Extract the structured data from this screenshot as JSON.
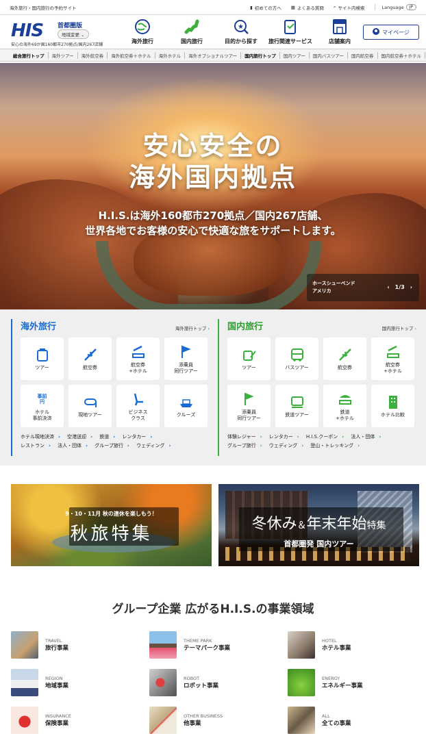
{
  "topbar": {
    "tagline": "海外旅行・国内旅行の予約サイト",
    "links": [
      "初めての方へ",
      "よくある質問",
      "サイト内検索"
    ],
    "language_label": "Language",
    "language_value": "JP"
  },
  "header": {
    "logo": "HIS",
    "area": "首都圏版",
    "area_change": "地域変更",
    "info": "安心の海外69か国160都市270拠点/国内267店舗",
    "nav": [
      "海外旅行",
      "国内旅行",
      "目的から探す",
      "旅行関連サービス",
      "店舗案内"
    ],
    "mypage": "マイページ"
  },
  "subnav": {
    "items": [
      "総合旅行トップ",
      "海外ツアー",
      "海外航空券",
      "海外航空券＋ホテル",
      "海外ホテル",
      "海外オプショナルツアー",
      "国内旅行トップ",
      "国内ツアー",
      "国内バスツアー",
      "国内航空券",
      "国内航空券＋ホテル"
    ]
  },
  "hero": {
    "title_line1": "安心安全の",
    "title_line2": "海外国内拠点",
    "subtitle_line1": "H.I.S.は海外160都市270拠点／国内267店舗、",
    "subtitle_line2": "世界各地でお客様の安心で快適な旅をサポートします。",
    "caption_line1": "ホースシューベンド",
    "caption_line2": "アメリカ",
    "pager": "1/3"
  },
  "overseas": {
    "title": "海外旅行",
    "top_link": "海外旅行トップ",
    "tiles": [
      "ツアー",
      "航空券",
      "航空券\n+ホテル",
      "添乗員\n同行ツアー",
      "ホテル\n事前決済",
      "現地ツアー",
      "ビジネス\nクラス",
      "クルーズ"
    ],
    "tile5_badge": "事前\n円",
    "links": [
      "ホテル現地決済",
      "空港送迎",
      "鉄道",
      "レンタカー",
      "レストラン",
      "法人・団体",
      "グループ旅行",
      "ウェディング"
    ]
  },
  "domestic": {
    "title": "国内旅行",
    "top_link": "国内旅行トップ",
    "tiles": [
      "ツアー",
      "バスツアー",
      "航空券",
      "航空券\n+ホテル",
      "添乗員\n同行ツアー",
      "鉄道ツアー",
      "鉄道\n+ホテル",
      "ホテル比較"
    ],
    "links": [
      "体験レジャー",
      "レンタカー",
      "H.I.S.クーポン",
      "法人・団体",
      "グループ旅行",
      "ウェディング",
      "登山・トレッキング"
    ]
  },
  "banners": {
    "autumn_small": "9・10・11月 秋の連休を楽しもう！",
    "autumn_big": "秋旅特集",
    "winter_big_a": "冬休み",
    "winter_amp": "＆",
    "winter_big_b": "年末年始",
    "winter_suffix": "特集",
    "winter_small": "首都圏発 国内ツアー"
  },
  "group": {
    "title": "グループ企業 広がるH.I.S.の事業領域",
    "items": [
      {
        "en": "TRAVEL",
        "jp": "旅行事業"
      },
      {
        "en": "THEME PARK",
        "jp": "テーマパーク事業"
      },
      {
        "en": "HOTEL",
        "jp": "ホテル事業"
      },
      {
        "en": "REGION",
        "jp": "地域事業"
      },
      {
        "en": "ROBOT",
        "jp": "ロボット事業"
      },
      {
        "en": "ENERGY",
        "jp": "エネルギー事業"
      },
      {
        "en": "INSURANCE",
        "jp": "保険事業"
      },
      {
        "en": "OTHER BUSINESS",
        "jp": "他事業"
      },
      {
        "en": "ALL",
        "jp": "全ての事業"
      }
    ]
  },
  "colors": {
    "brand": "#1a3f96",
    "overseas": "#1a6ad3",
    "domestic": "#3cb03c"
  }
}
